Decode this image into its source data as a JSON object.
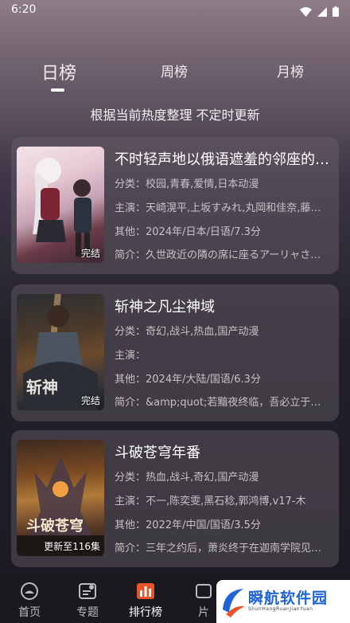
{
  "status_bar": {
    "time": "6:20"
  },
  "tabs": [
    {
      "label": "日榜",
      "active": true
    },
    {
      "label": "周榜",
      "active": false
    },
    {
      "label": "月榜",
      "active": false
    }
  ],
  "subtitle": "根据当前热度整理 不定时更新",
  "items": [
    {
      "title": "不时轻声地以俄语遮羞的邻座的艾莉同学",
      "category": "分类：校园,青春,爱情,日本动漫",
      "cast": "主演：天崎滉平,上坂すみれ,丸岡和佳奈,藤井ゆきよ",
      "other": "其他：2024年/日本/日语/7.3分",
      "intro": "简介：久世政近の隣の席に座るアーリャさんは",
      "badge": "完结"
    },
    {
      "title": "斩神之凡尘神域",
      "category": "分类：奇幻,战斗,热血,国产动漫",
      "cast": "主演：",
      "other": "其他：2024年/大陆/国语/6.3分",
      "intro": "简介：&amp;quot;若黯夜终临，吾必立于万万人前",
      "badge": "完结"
    },
    {
      "title": "斗破苍穹年番",
      "category": "分类：热血,战斗,奇幻,国产动漫",
      "cast": "主演：不一,陈奕雯,黑石稔,郭鸿博,v17-木",
      "other": "其他：2022年/中国/国语/3.5分",
      "intro": "简介：三年之约后，萧炎终于在迦南学院见到了",
      "badge": "更新至116集"
    }
  ],
  "bottom_nav": [
    {
      "label": "首页",
      "icon": "home-icon"
    },
    {
      "label": "专题",
      "icon": "topic-icon"
    },
    {
      "label": "排行榜",
      "icon": "ranking-icon",
      "active": true
    },
    {
      "label": "片",
      "icon": "film-icon"
    }
  ],
  "watermark": {
    "text": "瞬航软件园",
    "sub": "ShunHangRuanJianYuan"
  },
  "colors": {
    "accent": "#e8552a",
    "watermark_blue": "#1e64d8"
  }
}
